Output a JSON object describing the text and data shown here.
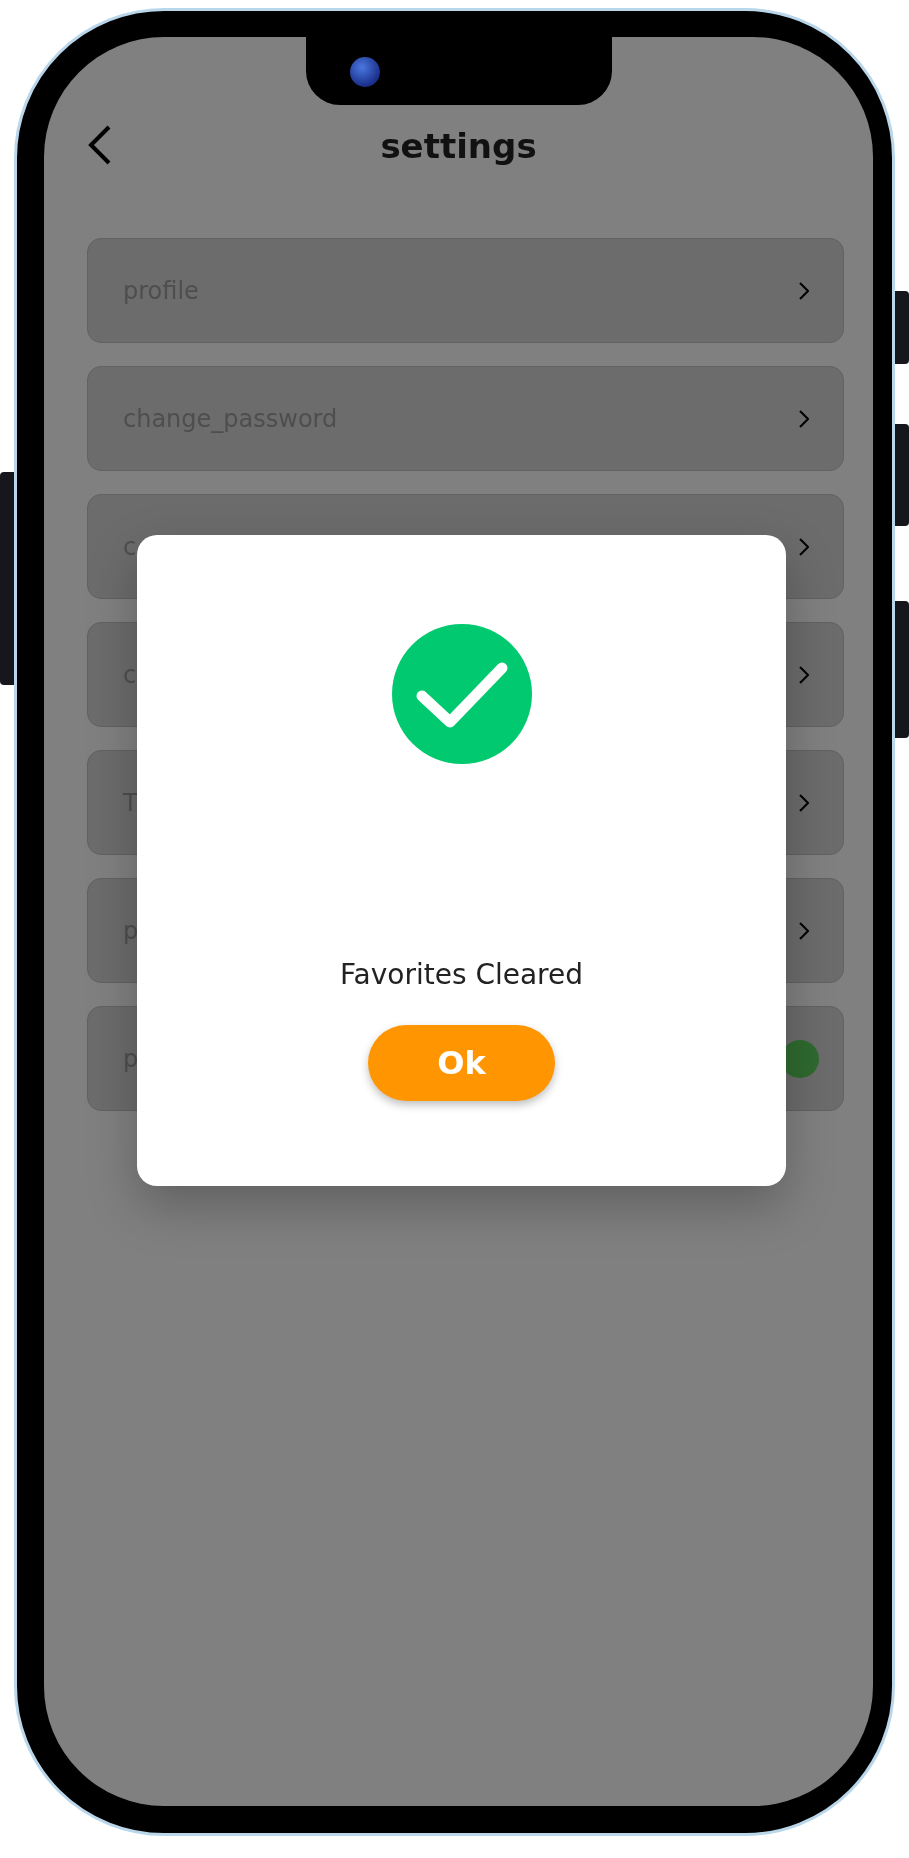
{
  "header": {
    "title": "settings"
  },
  "rows": [
    {
      "label": "profile",
      "kind": "chevron"
    },
    {
      "label": "change_password",
      "kind": "chevron"
    },
    {
      "label": "c",
      "kind": "chevron"
    },
    {
      "label": "c",
      "kind": "chevron"
    },
    {
      "label": "T",
      "kind": "chevron"
    },
    {
      "label": "p",
      "kind": "chevron"
    },
    {
      "label": "p",
      "kind": "toggle",
      "on": true
    }
  ],
  "dialog": {
    "message": "Favorites Cleared",
    "button": "Ok"
  }
}
